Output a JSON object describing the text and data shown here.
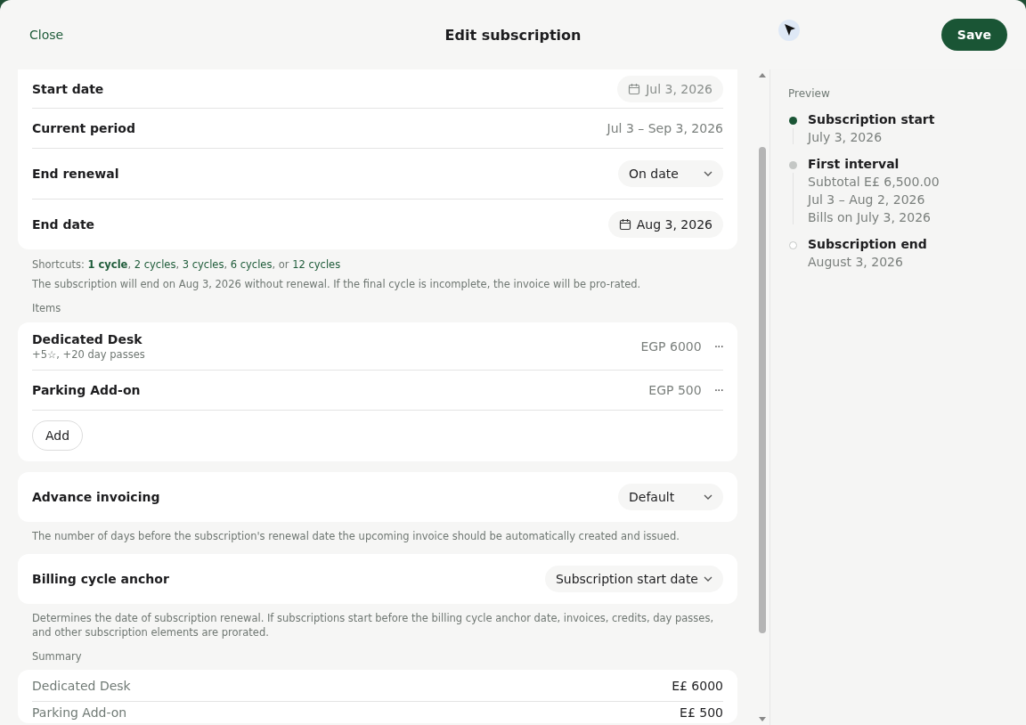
{
  "header": {
    "close": "Close",
    "title": "Edit subscription",
    "save": "Save"
  },
  "schedule": [
    {
      "kind": "date",
      "label": "Start date",
      "value": "Jul 3, 2026",
      "disabled": true
    },
    {
      "kind": "text",
      "label": "Current period",
      "value": "Jul 3 – Sep 3, 2026"
    },
    {
      "kind": "select",
      "label": "End renewal",
      "value": "On date"
    },
    {
      "kind": "date",
      "label": "End date",
      "value": "Aug 3, 2026",
      "disabled": false
    }
  ],
  "shortcuts": {
    "label": "Shortcuts:",
    "options": [
      {
        "label": "1 cycle",
        "selected": true,
        "suffix": ","
      },
      {
        "label": "2 cycles",
        "selected": false,
        "suffix": ","
      },
      {
        "label": "3 cycles",
        "selected": false,
        "suffix": ","
      },
      {
        "label": "6 cycles",
        "selected": false,
        "suffix": ", or"
      },
      {
        "label": "12 cycles",
        "selected": false
      }
    ]
  },
  "end_note": "The subscription will end on Aug 3, 2026 without renewal. If the final cycle is incomplete, the invoice will be pro-rated.",
  "items_label": "Items",
  "items": [
    {
      "name": "Dedicated Desk",
      "detail": "+5☆, +20 day passes",
      "price": "EGP 6000",
      "menu": "···"
    },
    {
      "name": "Parking Add-on",
      "price": "EGP 500",
      "menu": "···"
    }
  ],
  "add_button": "Add",
  "advance_invoicing": {
    "label": "Advance invoicing",
    "value": "Default",
    "note": "The number of days before the subscription's renewal date the upcoming invoice should be automatically created and issued."
  },
  "billing_anchor": {
    "label": "Billing cycle anchor",
    "value": "Subscription start date",
    "note": "Determines the date of subscription renewal. If subscriptions start before the billing cycle anchor date, invoices, credits, day passes, and other subscription elements are prorated."
  },
  "summary_label": "Summary",
  "summary": [
    {
      "name": "Dedicated Desk",
      "amount": "E£ 6000"
    },
    {
      "name": "Parking Add-on",
      "amount": "E£ 500"
    }
  ],
  "preview": {
    "label": "Preview",
    "events": [
      {
        "kind": "done",
        "title": "Subscription start",
        "lines": [
          "July 3, 2026"
        ]
      },
      {
        "kind": "pending",
        "title": "First interval",
        "lines": [
          "Subtotal E£ 6,500.00",
          "Jul 3 – Aug 2, 2026",
          "Bills on July 3, 2026"
        ]
      },
      {
        "kind": "end",
        "title": "Subscription end",
        "lines": [
          "August 3, 2026"
        ]
      }
    ]
  }
}
